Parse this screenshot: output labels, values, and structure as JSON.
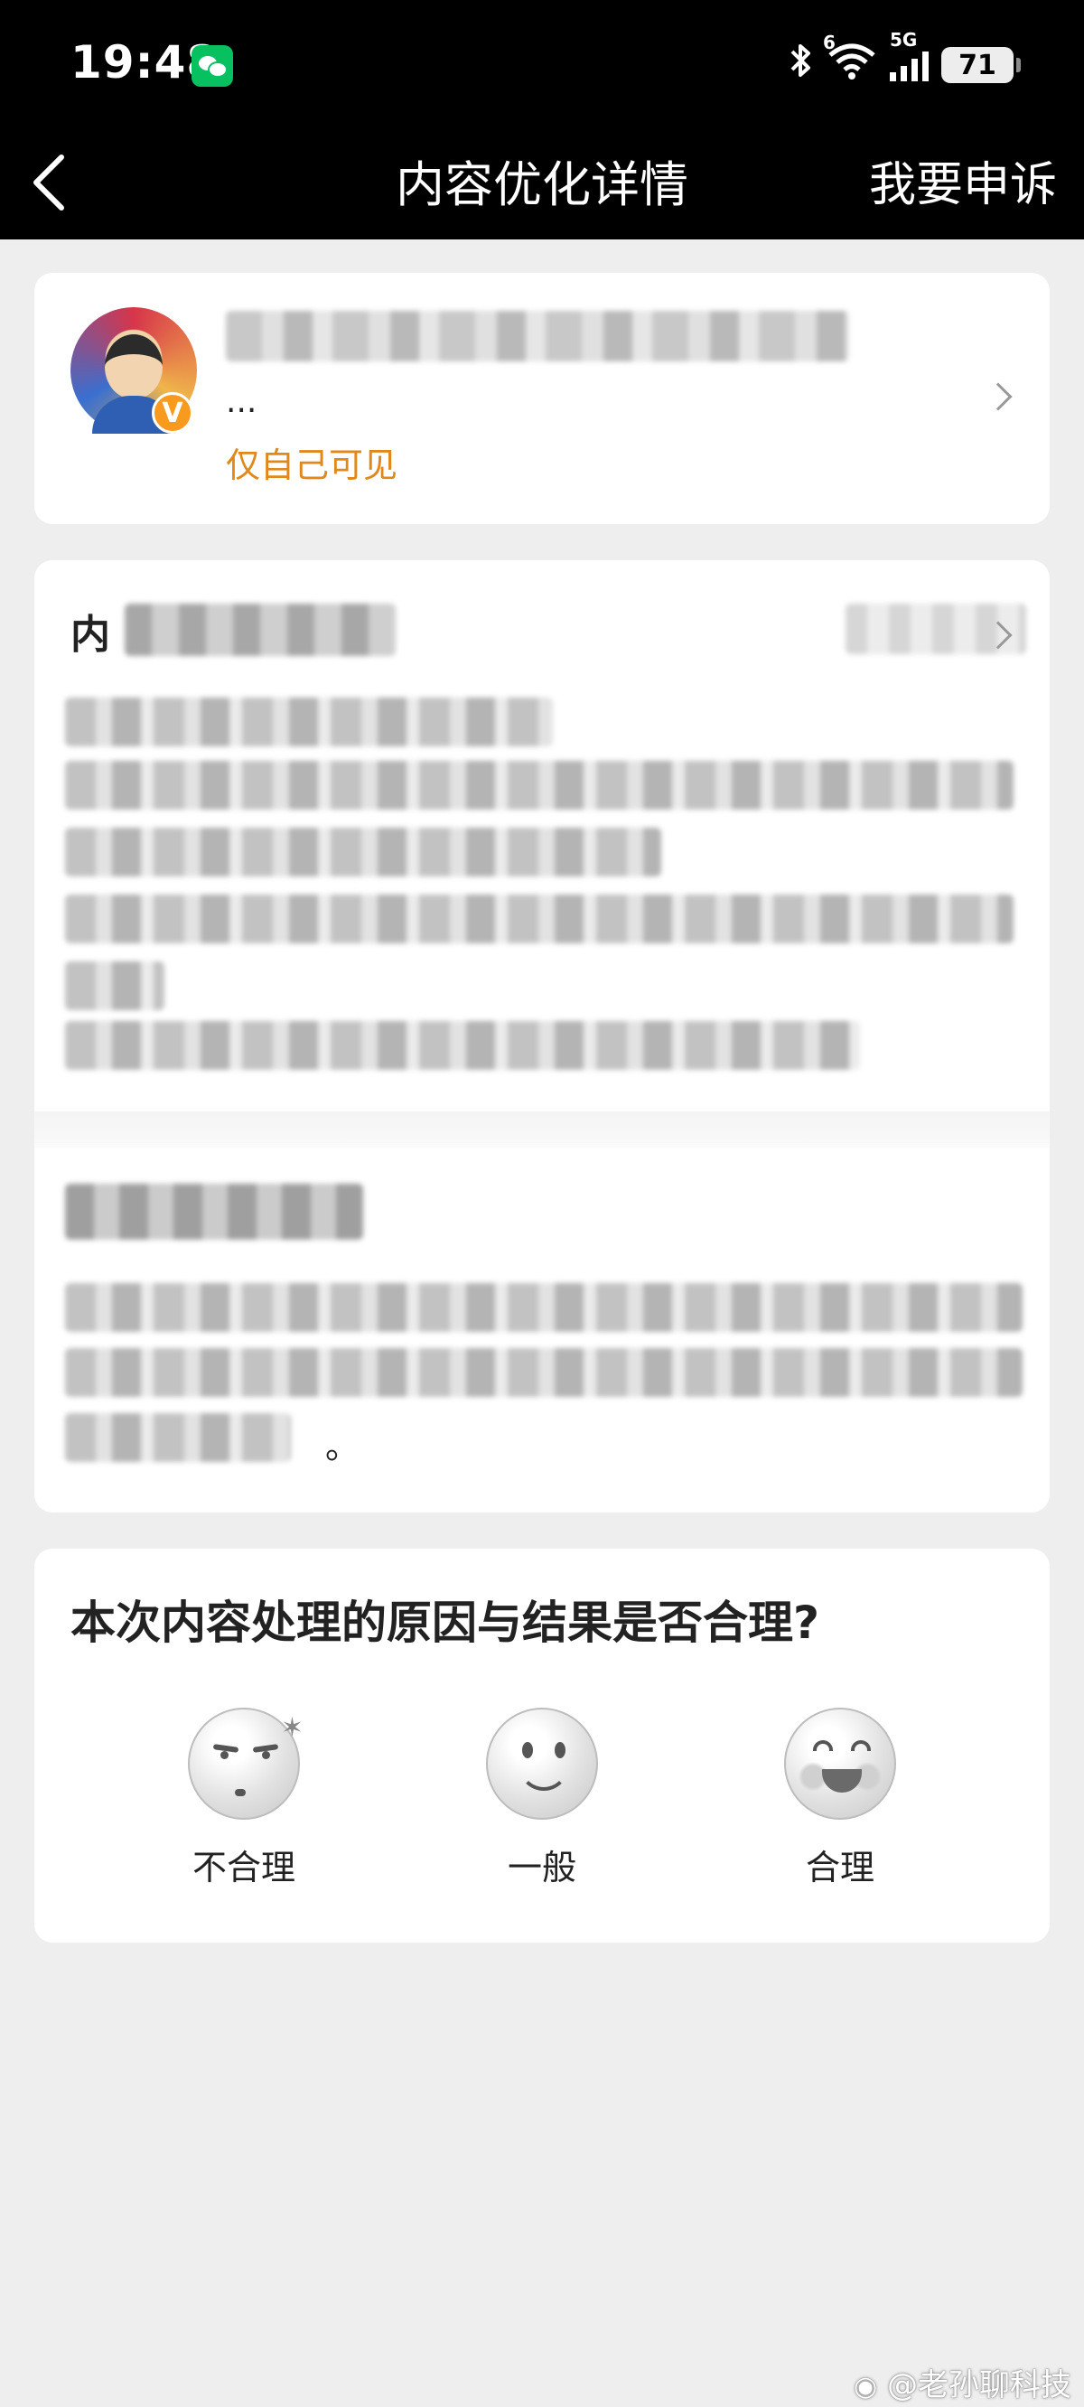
{
  "status_bar": {
    "time": "19:48",
    "wechat_icon": "wechat-icon",
    "bluetooth_icon": "bluetooth-icon",
    "wifi_label": "6",
    "network_label": "5G",
    "battery": "71"
  },
  "nav": {
    "title": "内容优化详情",
    "appeal_label": "我要申诉",
    "back_icon": "back-arrow-icon"
  },
  "post_card": {
    "ellipsis": "...",
    "visibility": "仅自己可见",
    "verified_badge": "V"
  },
  "detail_card": {
    "heading_prefix": "内",
    "tail_text": "。"
  },
  "rating": {
    "question": "本次内容处理的原因与结果是否合理?",
    "options": [
      {
        "label": "不合理",
        "icon": "angry-face-icon"
      },
      {
        "label": "一般",
        "icon": "neutral-face-icon"
      },
      {
        "label": "合理",
        "icon": "happy-face-icon"
      }
    ]
  },
  "watermark": "@老孙聊科技"
}
